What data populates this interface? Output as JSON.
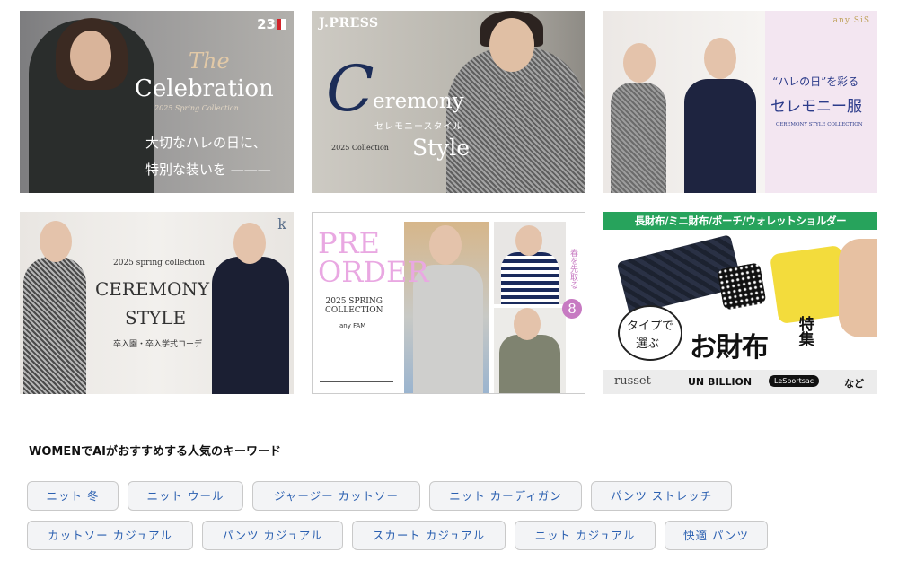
{
  "banners": {
    "b1": {
      "logo": "23",
      "the": "The",
      "celebration": "Celebration",
      "sub": "2025 Spring Collection",
      "jp_line1": "大切なハレの日に、",
      "jp_line2": "特別な装いを ———"
    },
    "b2": {
      "brand": "J.PRESS",
      "big_c": "C",
      "eremony": "eremony",
      "katakana": "セレモニースタイル",
      "collection": "2025 Collection",
      "style": "Style"
    },
    "b3": {
      "brand": "any SiS",
      "quote": "“ハレの日”を彩る",
      "title": "セレモニー服",
      "sub": "CEREMONY STYLE COLLECTION"
    },
    "b4": {
      "logo": "k",
      "spring": "2025 spring collection",
      "ceremony": "CEREMONY",
      "style": "STYLE",
      "jp": "卒入園・卒入学式コーデ"
    },
    "b5": {
      "pre": "PRE",
      "order": "ORDER",
      "spring": "2025 SPRING",
      "collection": "COLLECTION",
      "brand": "any FAM",
      "vertical": "春を先取る",
      "number": "8"
    },
    "b6": {
      "header": "長財布/ミニ財布/ポーチ/ウォレットショルダー",
      "bubble1": "タイプで",
      "bubble2": "選ぶ",
      "main": "お財布",
      "tokushu": "特集",
      "brand1": "russet",
      "brand2": "UN BILLION",
      "brand3": "LeSportsac",
      "nado": "など"
    }
  },
  "keywords": {
    "title": "WOMENでAIがおすすめする人気のキーワード",
    "row1": [
      "ニット 冬",
      "ニット ウール",
      "ジャージー カットソー",
      "ニット カーディガン",
      "パンツ ストレッチ"
    ],
    "row2": [
      "カットソー カジュアル",
      "パンツ カジュアル",
      "スカート カジュアル",
      "ニット カジュアル",
      "快適 パンツ"
    ]
  }
}
